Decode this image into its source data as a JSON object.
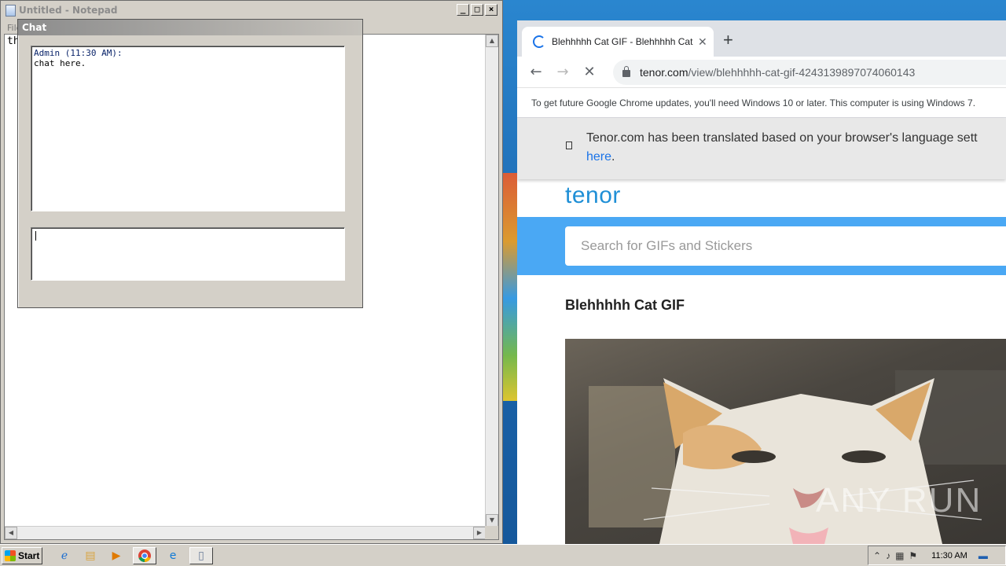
{
  "notepad": {
    "title": "Untitled - Notepad",
    "menu_first": "File",
    "text": "th"
  },
  "chat": {
    "title": "Chat",
    "messages": [
      {
        "author": "Admin (11:30 AM):",
        "text": "chat here."
      }
    ],
    "input_value": ""
  },
  "browser": {
    "tab_title": "Blehhhhh Cat GIF - Blehhhhh Cat - Di",
    "url_domain": "tenor.com",
    "url_path": "/view/blehhhhh-cat-gif-4243139897074060143",
    "update_notice": "To get future Google Chrome updates, you'll need Windows 10 or later. This computer is using Windows 7.",
    "translate_text": "Tenor.com has been translated based on your browser's language sett",
    "translate_link": "here",
    "translate_after": "."
  },
  "tenor": {
    "logo": "tenor",
    "search_placeholder": "Search for GIFs and Stickers",
    "gif_title": "Blehhhhh Cat GIF"
  },
  "taskbar": {
    "start_label": "Start",
    "clock": "11:30 AM"
  },
  "watermark": "ANY RUN"
}
